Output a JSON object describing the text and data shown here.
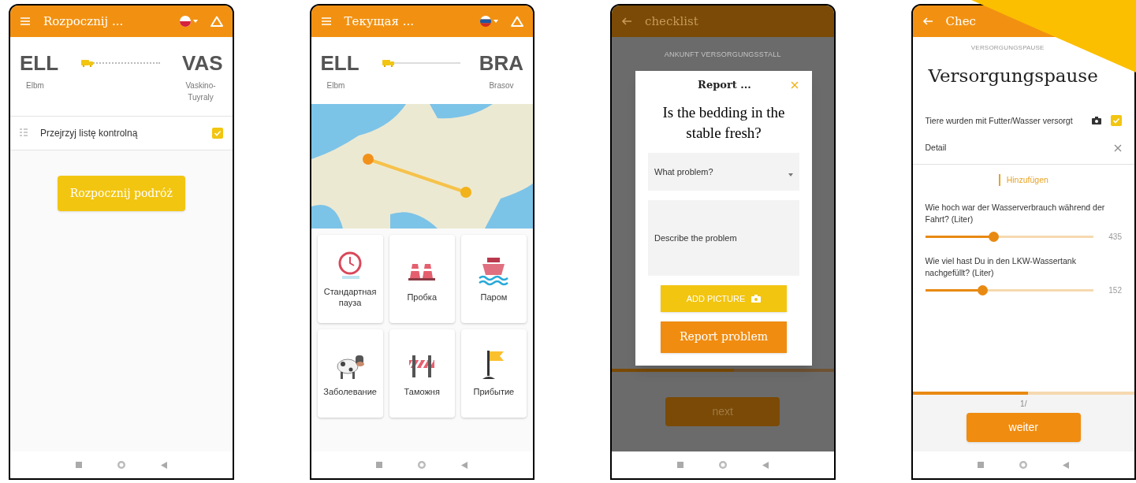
{
  "phones": [
    {
      "kind": "start",
      "header": {
        "title": "Rozpocznij ..."
      },
      "route": {
        "from_code": "ELL",
        "from_name": "Elbm",
        "to_code": "VAS",
        "to_name": "Vaskino-Tuyraly",
        "level": 0,
        "dotted": true
      },
      "checklist_row": {
        "label": "Przejrzyj listę kontrolną",
        "checked": true
      },
      "button": "Rozpocznij podróż"
    },
    {
      "kind": "trip",
      "header": {
        "title": "Текущая ..."
      },
      "route": {
        "from_code": "ELL",
        "from_name": "Elbm",
        "to_code": "BRA",
        "to_name": "Brasov",
        "level": 0,
        "dotted": false
      },
      "tiles": [
        {
          "kind": "pause",
          "label": "Стандартная пауза"
        },
        {
          "kind": "jam",
          "label": "Пробка"
        },
        {
          "kind": "ferry",
          "label": "Паром"
        },
        {
          "kind": "animal",
          "label": "Заболевание"
        },
        {
          "kind": "customs",
          "label": "Таможня"
        },
        {
          "kind": "arrival",
          "label": "Прибытие"
        }
      ]
    },
    {
      "kind": "report",
      "header": {
        "title": "checklist"
      },
      "section": "ANKUNFT VERSORGUNGSSTALL",
      "progress": {
        "level": 0.55
      },
      "next_button": "next",
      "dialog": {
        "title": "Report ...",
        "question": "Is the bedding in the stable fresh?",
        "select_placeholder": "What problem?",
        "text_placeholder": "Describe the problem",
        "picture_button": "ADD PICTURE",
        "submit_button": "Report problem"
      }
    },
    {
      "kind": "checklist",
      "header": {
        "title": "Chec"
      },
      "subtitle": "VERSORGUNGSPAUSE",
      "heading": "Versorgungspause",
      "task": {
        "label": "Tiere wurden mit Futter/Wasser versorgt",
        "checked": true
      },
      "detail": "Detail",
      "add_link": "Hinzufügen",
      "sliders": [
        {
          "label": "Wie hoch war der Wasserverbrauch während der Fahrt? (Liter)",
          "level": 0.4,
          "reading": "435"
        },
        {
          "label": "Wie viel hast Du in den LKW-Wassertank nachgefüllt? (Liter)",
          "level": 0.33,
          "reading": "152"
        }
      ],
      "progress": {
        "level": 0.52,
        "text": "1/"
      },
      "next_button": "weiter"
    }
  ]
}
